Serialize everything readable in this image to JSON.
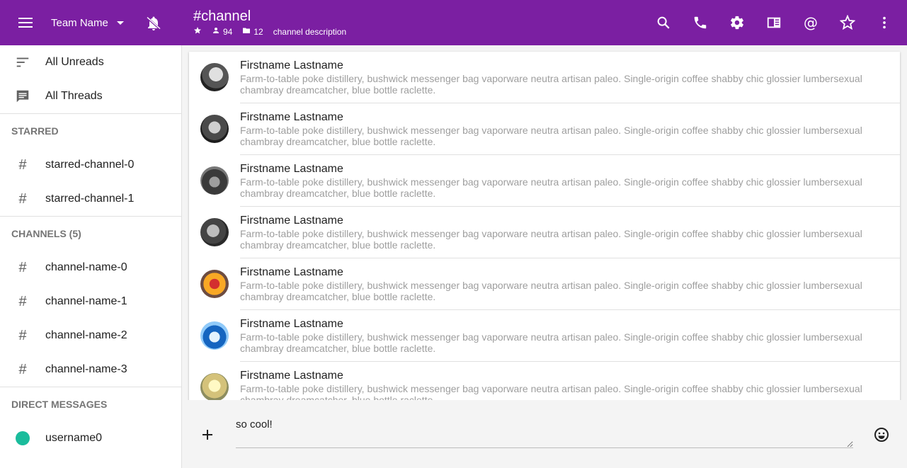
{
  "topbar": {
    "team_name": "Team Name",
    "channel_title": "#channel",
    "member_count": "94",
    "file_count": "12",
    "channel_description": "channel description",
    "accent": "#7b1fa2",
    "icons": [
      "search-icon",
      "phone-icon",
      "gear-icon",
      "sidebar-panel-icon",
      "at-mention-icon",
      "star-icon",
      "more-vert-icon"
    ]
  },
  "sidebar": {
    "all_unreads": "All Unreads",
    "all_threads": "All Threads",
    "starred_heading": "STARRED",
    "starred": [
      "starred-channel-0",
      "starred-channel-1"
    ],
    "channels_heading": "CHANNELS (5)",
    "channels": [
      "channel-name-0",
      "channel-name-1",
      "channel-name-2",
      "channel-name-3"
    ],
    "dm_heading": "DIRECT MESSAGES",
    "dms": [
      {
        "name": "username0",
        "status_color": "#1abc9c"
      }
    ]
  },
  "messages": [
    {
      "author": "Firstname Lastname",
      "text": "Farm-to-table poke distillery, bushwick messenger bag vaporware neutra artisan paleo. Single-origin coffee shabby chic glossier lumbersexual chambray dreamcatcher, blue bottle raclette."
    },
    {
      "author": "Firstname Lastname",
      "text": "Farm-to-table poke distillery, bushwick messenger bag vaporware neutra artisan paleo. Single-origin coffee shabby chic glossier lumbersexual chambray dreamcatcher, blue bottle raclette."
    },
    {
      "author": "Firstname Lastname",
      "text": "Farm-to-table poke distillery, bushwick messenger bag vaporware neutra artisan paleo. Single-origin coffee shabby chic glossier lumbersexual chambray dreamcatcher, blue bottle raclette."
    },
    {
      "author": "Firstname Lastname",
      "text": "Farm-to-table poke distillery, bushwick messenger bag vaporware neutra artisan paleo. Single-origin coffee shabby chic glossier lumbersexual chambray dreamcatcher, blue bottle raclette."
    },
    {
      "author": "Firstname Lastname",
      "text": "Farm-to-table poke distillery, bushwick messenger bag vaporware neutra artisan paleo. Single-origin coffee shabby chic glossier lumbersexual chambray dreamcatcher, blue bottle raclette."
    },
    {
      "author": "Firstname Lastname",
      "text": "Farm-to-table poke distillery, bushwick messenger bag vaporware neutra artisan paleo. Single-origin coffee shabby chic glossier lumbersexual chambray dreamcatcher, blue bottle raclette."
    },
    {
      "author": "Firstname Lastname",
      "text": "Farm-to-table poke distillery, bushwick messenger bag vaporware neutra artisan paleo. Single-origin coffee shabby chic glossier lumbersexual chambray dreamcatcher, blue bottle raclette."
    }
  ],
  "composer": {
    "value": "so cool!"
  }
}
